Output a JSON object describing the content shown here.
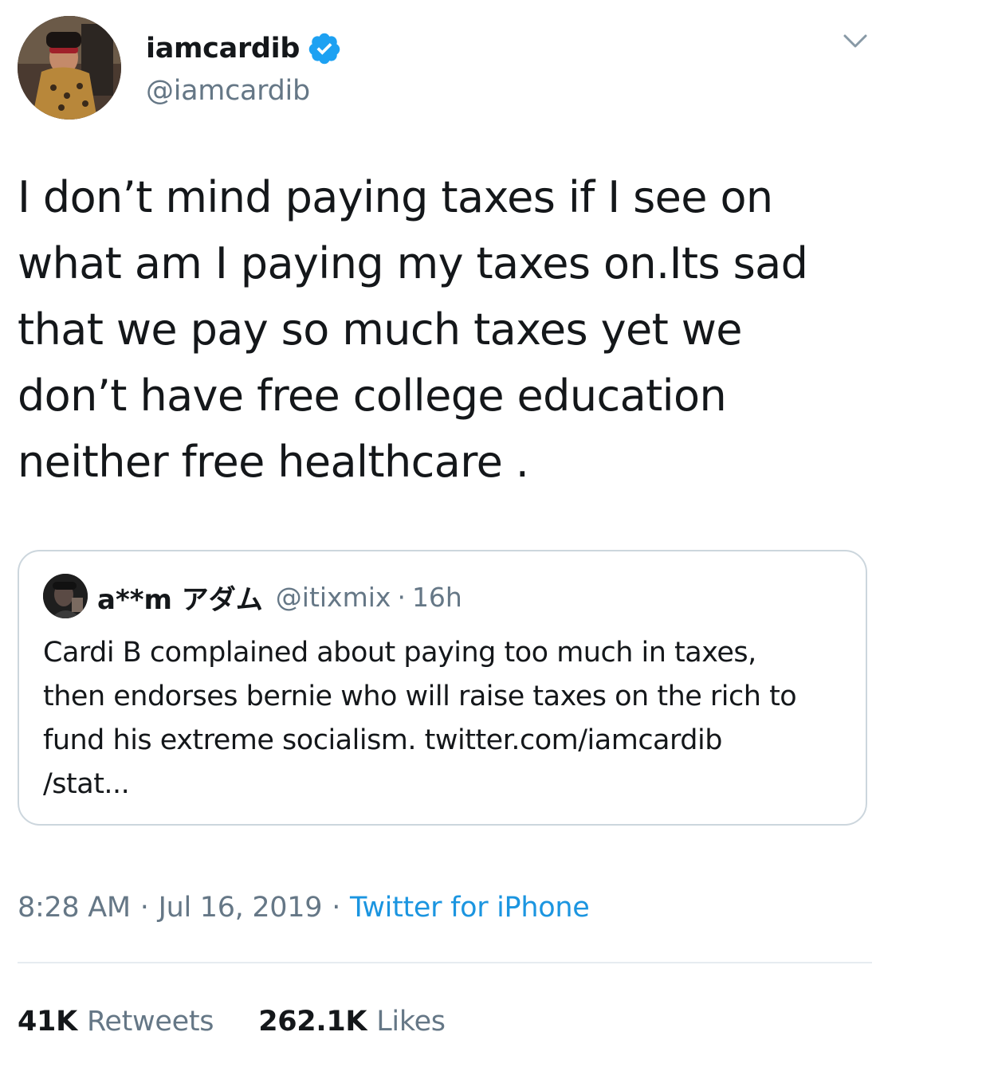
{
  "author": {
    "display_name": "iamcardib",
    "handle": "@iamcardib",
    "verified": true,
    "avatar_icon": "profile-photo"
  },
  "tweet": {
    "text_lines": [
      "I don’t mind paying taxes if I see on",
      "what am I paying my taxes on.Its sad",
      "that we pay so much taxes yet we",
      "don’t have free college education",
      "neither free healthcare ."
    ]
  },
  "quoted_tweet": {
    "display_name": "a**m アダム",
    "handle": "@itixmix",
    "separator": "·",
    "time": "16h",
    "text_lines": [
      "Cardi B complained about paying too much in taxes,",
      "then endorses bernie who will raise taxes on the rich to",
      "fund his extreme socialism. twitter.com/iamcardib",
      "/stat..."
    ]
  },
  "meta": {
    "time": "8:28 AM",
    "separator": "·",
    "date": "Jul 16, 2019",
    "source": "Twitter for iPhone"
  },
  "stats": {
    "retweets_count": "41K",
    "retweets_label": "Retweets",
    "likes_count": "262.1K",
    "likes_label": "Likes"
  },
  "colors": {
    "text_primary": "#14171a",
    "text_secondary": "#657786",
    "link": "#1b95e0",
    "verified_badge": "#1da1f2",
    "border": "#ccd6dd",
    "divider": "#e6ecf0"
  }
}
